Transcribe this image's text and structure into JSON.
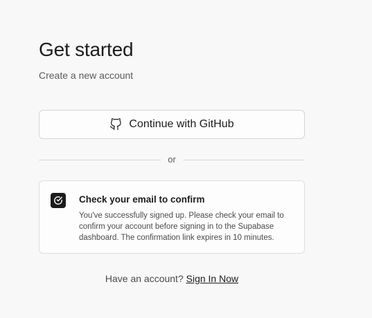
{
  "header": {
    "title": "Get started",
    "subtitle": "Create a new account"
  },
  "auth": {
    "github_icon": "github-icon",
    "github_label": "Continue with GitHub",
    "divider_text": "or"
  },
  "alert": {
    "icon": "check-circle-icon",
    "title": "Check your email to confirm",
    "body": "You've successfully signed up. Please check your email to confirm your account before signing in to the Supabase dashboard. The confirmation link expires in 10 minutes."
  },
  "footer": {
    "prompt": "Have an account?",
    "link_label": "Sign In Now"
  }
}
